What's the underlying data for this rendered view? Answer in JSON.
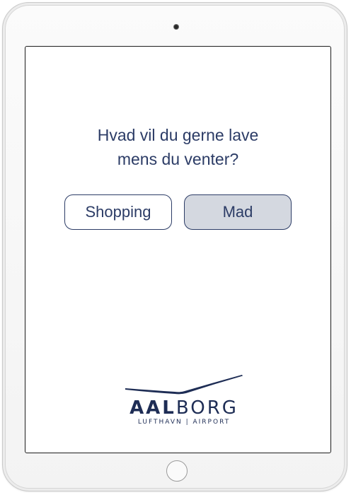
{
  "prompt": {
    "line1": "Hvad vil du gerne lave",
    "line2": "mens du venter?"
  },
  "choices": {
    "shopping_label": "Shopping",
    "mad_label": "Mad"
  },
  "logo": {
    "bold_part": "AAL",
    "light_part": "BORG",
    "subtitle": "LUFTHAVN | AIRPORT"
  },
  "colors": {
    "brand_navy": "#2c3c66",
    "selected_button_fill": "#d4d8e0"
  }
}
